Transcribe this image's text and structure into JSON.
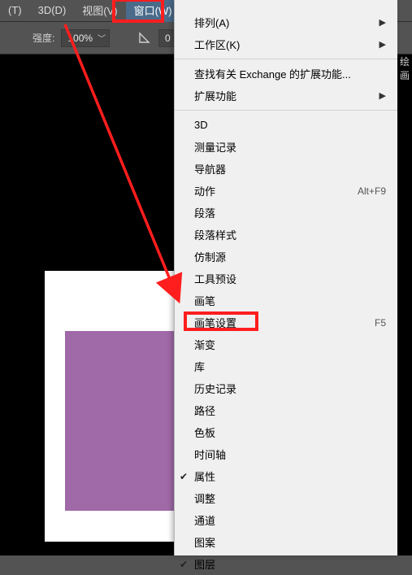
{
  "menubar": {
    "items": [
      {
        "label": "(T)"
      },
      {
        "label": "3D(D)"
      },
      {
        "label": "视图(V)"
      },
      {
        "label": "窗口(W)",
        "active": true
      }
    ]
  },
  "toolbar": {
    "strength_label": "强度:",
    "strength_value": "100%",
    "angle_value": "0"
  },
  "right_hint": "绘画",
  "dropdown": {
    "groups": [
      [
        {
          "label": "排列(A)",
          "submenu": true
        },
        {
          "label": "工作区(K)",
          "submenu": true
        }
      ],
      [
        {
          "label": "查找有关 Exchange 的扩展功能..."
        },
        {
          "label": "扩展功能",
          "submenu": true
        }
      ],
      [
        {
          "label": "3D"
        },
        {
          "label": "测量记录"
        },
        {
          "label": "导航器"
        },
        {
          "label": "动作",
          "shortcut": "Alt+F9"
        },
        {
          "label": "段落"
        },
        {
          "label": "段落样式"
        },
        {
          "label": "仿制源"
        },
        {
          "label": "工具预设"
        },
        {
          "label": "画笔"
        },
        {
          "label": "画笔设置",
          "shortcut": "F5"
        },
        {
          "label": "渐变"
        },
        {
          "label": "库"
        },
        {
          "label": "历史记录"
        },
        {
          "label": "路径"
        },
        {
          "label": "色板"
        },
        {
          "label": "时间轴"
        },
        {
          "label": "属性",
          "checked": true
        },
        {
          "label": "调整"
        },
        {
          "label": "通道"
        },
        {
          "label": "图案"
        },
        {
          "label": "图层",
          "checked": true
        }
      ]
    ]
  },
  "annotations": {
    "menu_highlight": "窗口(W)",
    "item_highlight": "画笔设置"
  }
}
